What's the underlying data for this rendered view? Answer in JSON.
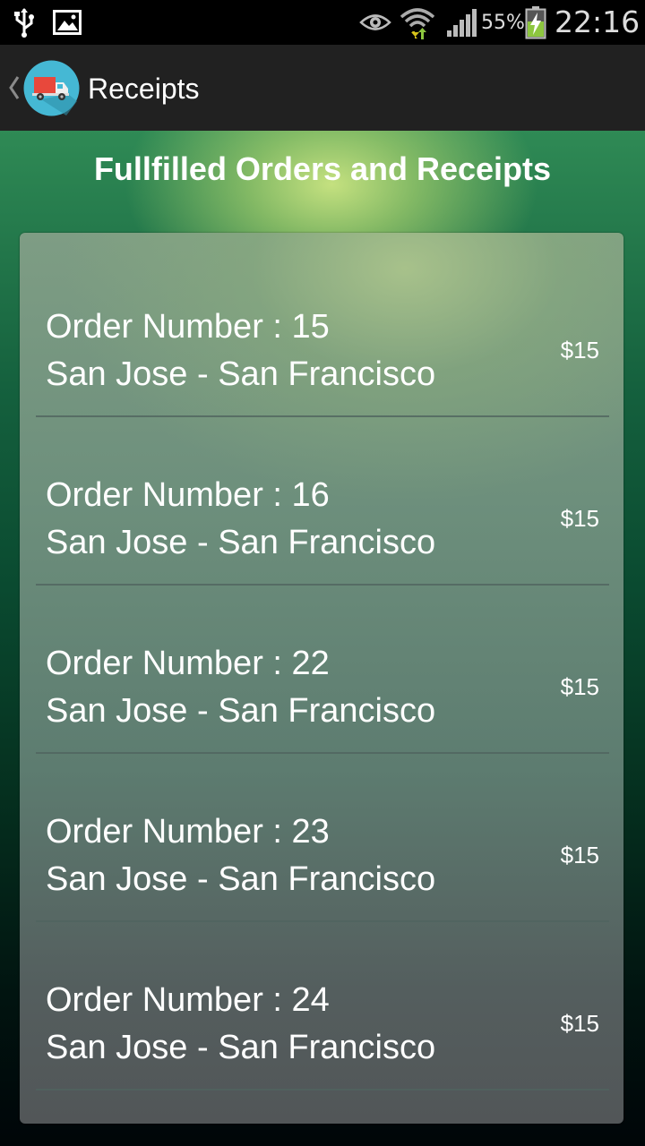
{
  "status_bar": {
    "battery_percent": "55%",
    "time": "22:16",
    "icons": [
      "usb-icon",
      "image-icon",
      "eye-icon",
      "wifi-icon",
      "signal-icon",
      "battery-charging-icon"
    ]
  },
  "action_bar": {
    "title": "Receipts",
    "logo": "delivery-truck-logo",
    "up_icon": "chevron-left-icon"
  },
  "main": {
    "heading": "Fullfilled Orders and Receipts",
    "orders": [
      {
        "order_line": "Order Number : 15",
        "route": "San Jose - San Francisco",
        "price": "$15"
      },
      {
        "order_line": "Order Number : 16",
        "route": "San Jose - San Francisco",
        "price": "$15"
      },
      {
        "order_line": "Order Number : 22",
        "route": "San Jose - San Francisco",
        "price": "$15"
      },
      {
        "order_line": "Order Number : 23",
        "route": "San Jose - San Francisco",
        "price": "$15"
      },
      {
        "order_line": "Order Number : 24",
        "route": "San Jose - San Francisco",
        "price": "$15"
      }
    ]
  },
  "colors": {
    "action_bar": "#212121",
    "logo_circle": "#45b8d4",
    "truck_red": "#e8483c"
  }
}
